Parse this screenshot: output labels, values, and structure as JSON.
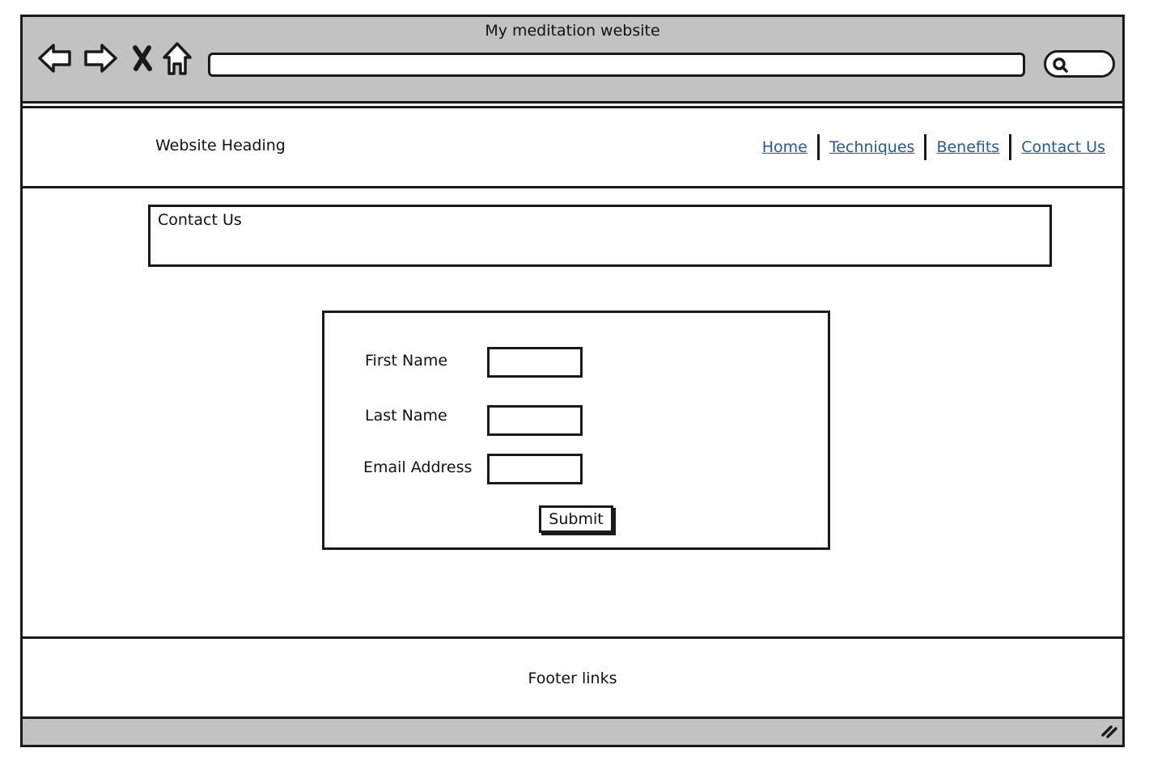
{
  "window": {
    "title": "My meditation website"
  },
  "toolbar": {
    "icons": [
      "back-arrow-icon",
      "forward-arrow-icon",
      "close-icon",
      "home-icon",
      "search-icon"
    ],
    "url_value": ""
  },
  "header": {
    "heading": "Website Heading",
    "nav": [
      {
        "label": "Home"
      },
      {
        "label": "Techniques"
      },
      {
        "label": "Benefits"
      },
      {
        "label": "Contact Us"
      }
    ],
    "link_color": "#1f5a9c"
  },
  "page": {
    "title": "Contact Us"
  },
  "form": {
    "first_name_label": "First Name",
    "last_name_label": "Last Name",
    "email_label": "Email Address",
    "first_name_value": "",
    "last_name_value": "",
    "email_value": "",
    "submit_label": "Submit"
  },
  "footer": {
    "text": "Footer links"
  },
  "colors": {
    "chrome": "#c2c2c2",
    "border": "#1a1a1a"
  }
}
